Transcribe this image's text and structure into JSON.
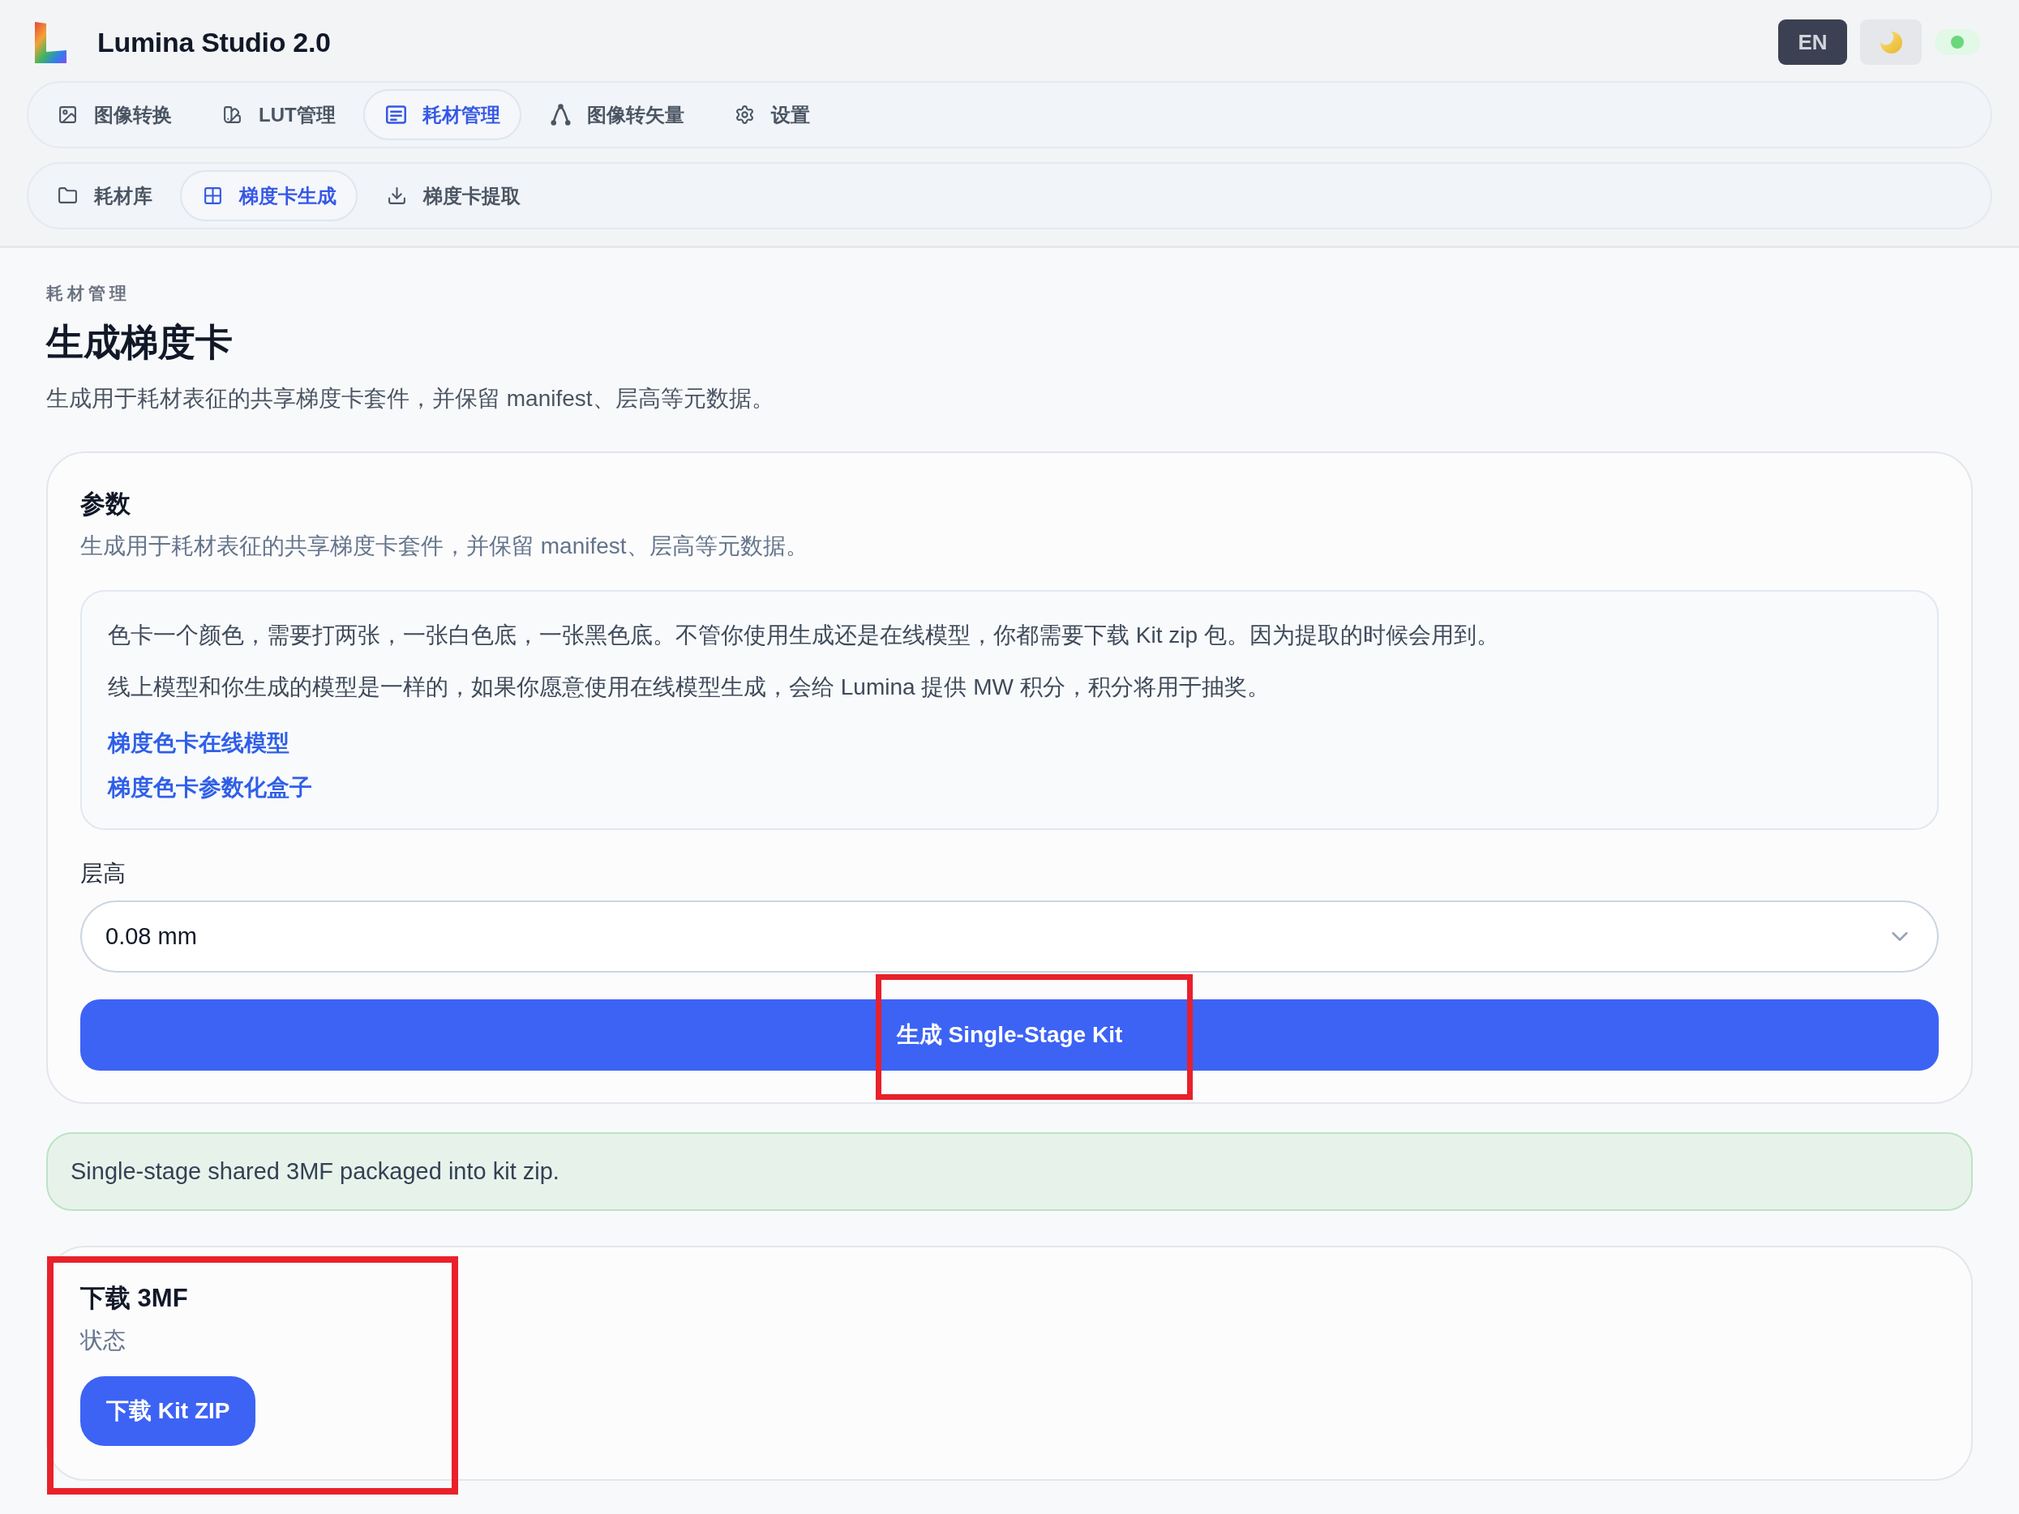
{
  "app": {
    "title": "Lumina Studio 2.0"
  },
  "header_controls": {
    "language_button": "EN",
    "status_indicator": {
      "on": true
    }
  },
  "main_tabs": [
    {
      "label": "图像转换",
      "selected": false
    },
    {
      "label": "LUT管理",
      "selected": false
    },
    {
      "label": "耗材管理",
      "selected": true
    },
    {
      "label": "图像转矢量",
      "selected": false
    },
    {
      "label": "设置",
      "selected": false
    }
  ],
  "sub_tabs": [
    {
      "label": "耗材库",
      "selected": false
    },
    {
      "label": "梯度卡生成",
      "selected": true
    },
    {
      "label": "梯度卡提取",
      "selected": false
    }
  ],
  "page": {
    "eyebrow": "耗材管理",
    "title": "生成梯度卡",
    "description": "生成用于耗材表征的共享梯度卡套件，并保留 manifest、层高等元数据。"
  },
  "parameters_panel": {
    "title": "参数",
    "description": "生成用于耗材表征的共享梯度卡套件，并保留 manifest、层高等元数据。",
    "info": {
      "paragraphs": [
        "色卡一个颜色，需要打两张，一张白色底，一张黑色底。不管你使用生成还是在线模型，你都需要下载 Kit zip 包。因为提取的时候会用到。",
        "线上模型和你生成的模型是一样的，如果你愿意使用在线模型生成，会给 Lumina 提供 MW 积分，积分将用于抽奖。"
      ],
      "links": [
        "梯度色卡在线模型",
        "梯度色卡参数化盒子"
      ]
    },
    "layer_height": {
      "label": "层高",
      "value": "0.08 mm"
    },
    "generate_button": {
      "label": "生成 Single-Stage Kit",
      "highlighted": true
    }
  },
  "status_message": {
    "kind": "success",
    "text": "Single-stage shared 3MF packaged into kit zip."
  },
  "download_panel": {
    "title": "下载 3MF",
    "status_label": "状态",
    "download_button": "下载 Kit ZIP",
    "highlighted": true
  }
}
